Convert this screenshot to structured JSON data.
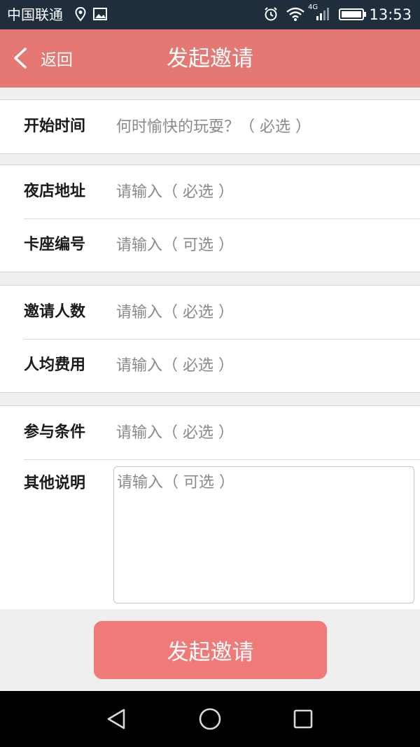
{
  "status_bar": {
    "carrier": "中国联通",
    "network": "4G",
    "time": "13:53",
    "icons": [
      "location-icon",
      "image-icon",
      "alarm-icon",
      "wifi-icon",
      "signal-icon",
      "battery-icon"
    ]
  },
  "header": {
    "back_label": "返回",
    "title": "发起邀请",
    "background": "#e57873"
  },
  "form": {
    "groups": [
      [
        {
          "label": "开始时间",
          "placeholder": "何时愉快的玩耍？（ 必选 ）"
        }
      ],
      [
        {
          "label": "夜店地址",
          "placeholder": "请输入（ 必选 ）"
        },
        {
          "label": "卡座编号",
          "placeholder": "请输入（ 可选 ）"
        }
      ],
      [
        {
          "label": "邀请人数",
          "placeholder": "请输入（ 必选 ）"
        },
        {
          "label": "人均费用",
          "placeholder": "请输入（ 必选 ）"
        }
      ],
      [
        {
          "label": "参与条件",
          "placeholder": "请输入（ 必选 ）"
        },
        {
          "label": "其他说明",
          "placeholder": "请输入（ 可选 ）"
        }
      ]
    ]
  },
  "submit_label": "发起邀请",
  "accent_color": "#f07a78",
  "nav_bar": {
    "icons": [
      "back-triangle-icon",
      "home-circle-icon",
      "recents-square-icon"
    ]
  }
}
